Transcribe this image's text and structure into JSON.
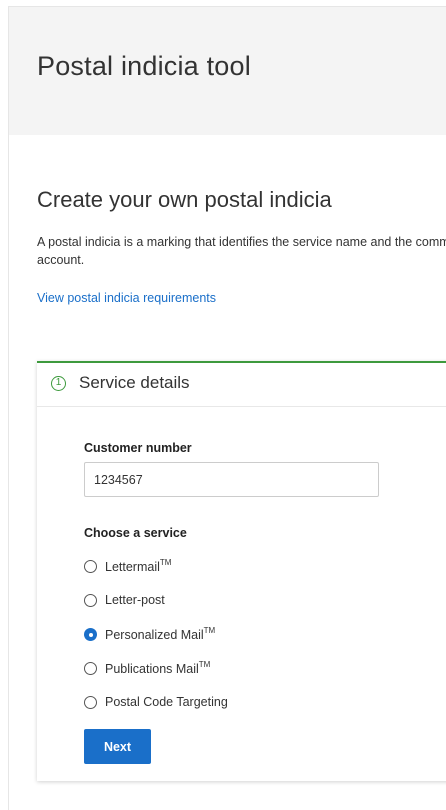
{
  "header": {
    "title": "Postal indicia tool"
  },
  "main": {
    "heading": "Create your own postal indicia",
    "intro": "A postal indicia is a marking that identifies the service name and the commercial account.",
    "requirements_link": "View postal indicia requirements"
  },
  "step": {
    "number": "1",
    "title": "Service details",
    "customer_number_label": "Customer number",
    "customer_number_value": "1234567",
    "service_label": "Choose a service",
    "services": [
      {
        "label": "Lettermail",
        "mark": "TM",
        "selected": false
      },
      {
        "label": "Letter-post",
        "mark": "",
        "selected": false
      },
      {
        "label": "Personalized Mail",
        "mark": "TM",
        "selected": true
      },
      {
        "label": "Publications Mail",
        "mark": "TM",
        "selected": false
      },
      {
        "label": "Postal Code Targeting",
        "mark": "",
        "selected": false
      }
    ],
    "next_label": "Next"
  },
  "colors": {
    "accent_blue": "#1a6fc9",
    "step_green": "#3d9a3d",
    "header_bg": "#f4f4f4"
  }
}
